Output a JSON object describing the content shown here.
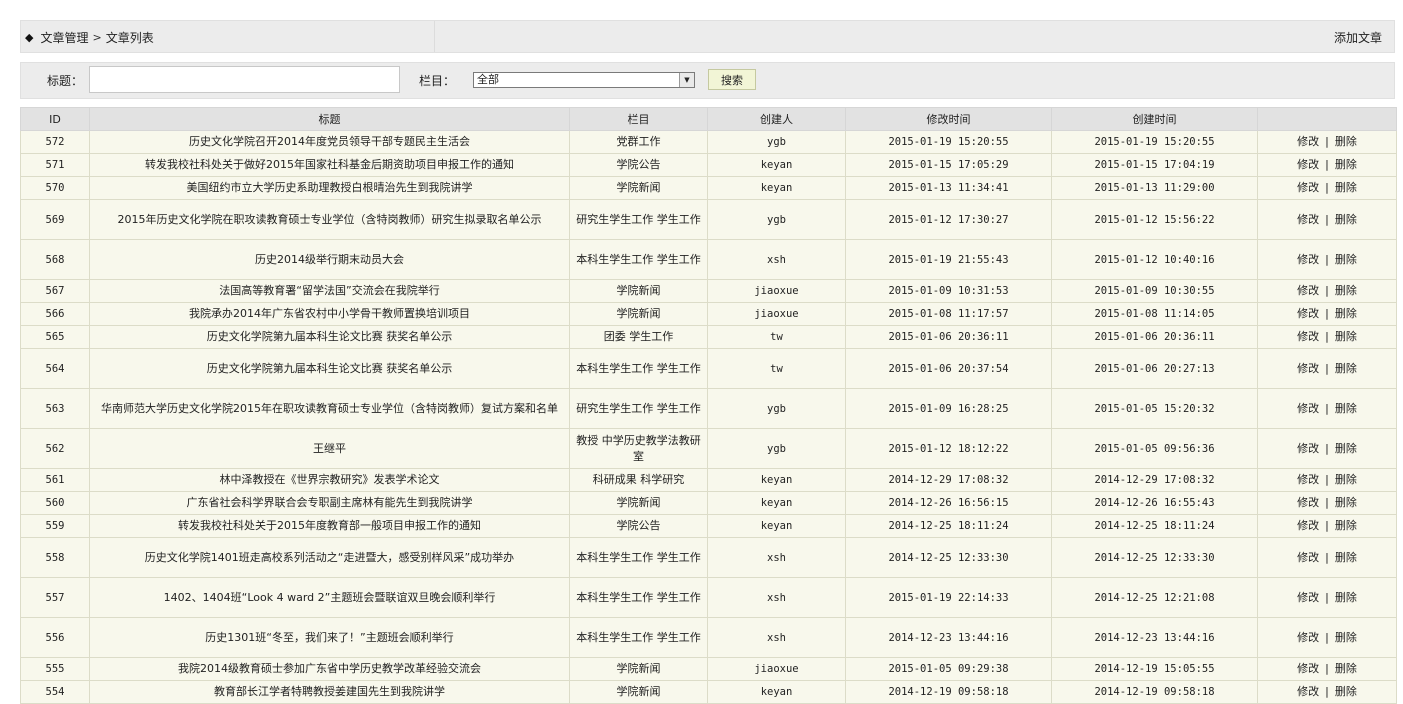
{
  "breadcrumb": {
    "root": "文章管理",
    "current": "文章列表",
    "add_label": "添加文章"
  },
  "filter": {
    "title_label": "标题：",
    "title_value": "",
    "category_label": "栏目：",
    "category_selected": "全部",
    "search_label": "搜索"
  },
  "table": {
    "headers": [
      "ID",
      "标题",
      "栏目",
      "创建人",
      "修改时间",
      "创建时间",
      ""
    ],
    "edit_label": "修改",
    "delete_label": "删除",
    "separator": "|",
    "rows": [
      {
        "id": "572",
        "title": "历史文化学院召开2014年度党员领导干部专题民主生活会",
        "category": "党群工作",
        "creator": "ygb",
        "modified": "2015-01-19 15:20:55",
        "created": "2015-01-19 15:20:55"
      },
      {
        "id": "571",
        "title": "转发我校社科处关于做好2015年国家社科基金后期资助项目申报工作的通知",
        "category": "学院公告",
        "creator": "keyan",
        "modified": "2015-01-15 17:05:29",
        "created": "2015-01-15 17:04:19"
      },
      {
        "id": "570",
        "title": "美国纽约市立大学历史系助理教授白根晴治先生到我院讲学",
        "category": "学院新闻",
        "creator": "keyan",
        "modified": "2015-01-13 11:34:41",
        "created": "2015-01-13 11:29:00"
      },
      {
        "id": "569",
        "title": "2015年历史文化学院在职攻读教育硕士专业学位（含特岗教师）研究生拟录取名单公示",
        "category": "研究生学生工作 学生工作",
        "creator": "ygb",
        "modified": "2015-01-12 17:30:27",
        "created": "2015-01-12 15:56:22",
        "tall": true
      },
      {
        "id": "568",
        "title": "历史2014级举行期末动员大会",
        "category": "本科生学生工作 学生工作",
        "creator": "xsh",
        "modified": "2015-01-19 21:55:43",
        "created": "2015-01-12 10:40:16",
        "tall": true
      },
      {
        "id": "567",
        "title": "法国高等教育署“留学法国”交流会在我院举行",
        "category": "学院新闻",
        "creator": "jiaoxue",
        "modified": "2015-01-09 10:31:53",
        "created": "2015-01-09 10:30:55"
      },
      {
        "id": "566",
        "title": "我院承办2014年广东省农村中小学骨干教师置换培训项目",
        "category": "学院新闻",
        "creator": "jiaoxue",
        "modified": "2015-01-08 11:17:57",
        "created": "2015-01-08 11:14:05"
      },
      {
        "id": "565",
        "title": "历史文化学院第九届本科生论文比赛 获奖名单公示",
        "category": "团委 学生工作",
        "creator": "tw",
        "modified": "2015-01-06 20:36:11",
        "created": "2015-01-06 20:36:11"
      },
      {
        "id": "564",
        "title": "历史文化学院第九届本科生论文比赛 获奖名单公示",
        "category": "本科生学生工作 学生工作",
        "creator": "tw",
        "modified": "2015-01-06 20:37:54",
        "created": "2015-01-06 20:27:13",
        "tall": true
      },
      {
        "id": "563",
        "title": "华南师范大学历史文化学院2015年在职攻读教育硕士专业学位（含特岗教师）复试方案和名单",
        "category": "研究生学生工作 学生工作",
        "creator": "ygb",
        "modified": "2015-01-09 16:28:25",
        "created": "2015-01-05 15:20:32",
        "tall": true
      },
      {
        "id": "562",
        "title": "王继平",
        "category": "教授 中学历史教学法教研室",
        "creator": "ygb",
        "modified": "2015-01-12 18:12:22",
        "created": "2015-01-05 09:56:36",
        "tall": true
      },
      {
        "id": "561",
        "title": "林中泽教授在《世界宗教研究》发表学术论文",
        "category": "科研成果 科学研究",
        "creator": "keyan",
        "modified": "2014-12-29 17:08:32",
        "created": "2014-12-29 17:08:32"
      },
      {
        "id": "560",
        "title": "广东省社会科学界联合会专职副主席林有能先生到我院讲学",
        "category": "学院新闻",
        "creator": "keyan",
        "modified": "2014-12-26 16:56:15",
        "created": "2014-12-26 16:55:43"
      },
      {
        "id": "559",
        "title": "转发我校社科处关于2015年度教育部一般项目申报工作的通知",
        "category": "学院公告",
        "creator": "keyan",
        "modified": "2014-12-25 18:11:24",
        "created": "2014-12-25 18:11:24"
      },
      {
        "id": "558",
        "title": "历史文化学院1401班走高校系列活动之“走进暨大，感受别样风采”成功举办",
        "category": "本科生学生工作 学生工作",
        "creator": "xsh",
        "modified": "2014-12-25 12:33:30",
        "created": "2014-12-25 12:33:30",
        "tall": true
      },
      {
        "id": "557",
        "title": "1402、1404班“Look 4 ward 2”主题班会暨联谊双旦晚会顺利举行",
        "category": "本科生学生工作 学生工作",
        "creator": "xsh",
        "modified": "2015-01-19 22:14:33",
        "created": "2014-12-25 12:21:08",
        "tall": true
      },
      {
        "id": "556",
        "title": "历史1301班“冬至，我们来了！”主题班会顺利举行",
        "category": "本科生学生工作 学生工作",
        "creator": "xsh",
        "modified": "2014-12-23 13:44:16",
        "created": "2014-12-23 13:44:16",
        "tall": true
      },
      {
        "id": "555",
        "title": "我院2014级教育硕士参加广东省中学历史教学改革经验交流会",
        "category": "学院新闻",
        "creator": "jiaoxue",
        "modified": "2015-01-05 09:29:38",
        "created": "2014-12-19 15:05:55"
      },
      {
        "id": "554",
        "title": "教育部长江学者特聘教授姜建国先生到我院讲学",
        "category": "学院新闻",
        "creator": "keyan",
        "modified": "2014-12-19 09:58:18",
        "created": "2014-12-19 09:58:18"
      }
    ]
  }
}
